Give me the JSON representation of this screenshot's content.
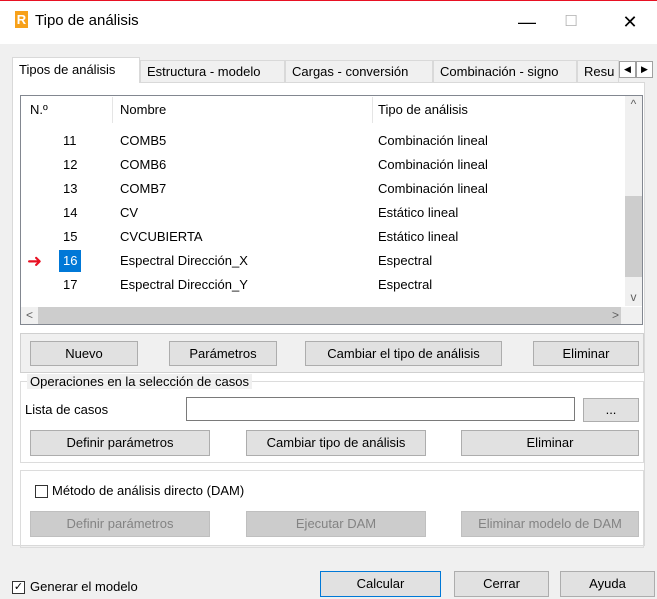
{
  "window": {
    "title": "Tipo de análisis",
    "app_icon_letter": "R",
    "minimize_glyph": "—",
    "maximize_glyph": "☐",
    "close_glyph": "✕"
  },
  "tabs": [
    {
      "label": "Tipos de análisis",
      "active": true
    },
    {
      "label": "Estructura - modelo",
      "active": false
    },
    {
      "label": "Cargas - conversión",
      "active": false
    },
    {
      "label": "Combinación - signo",
      "active": false
    },
    {
      "label": "Resu",
      "active": false
    }
  ],
  "tab_scroll": {
    "left": "◀",
    "right": "▶"
  },
  "list": {
    "columns": {
      "num": "N.º",
      "name": "Nombre",
      "type": "Tipo de análisis"
    },
    "rows": [
      {
        "num": "11",
        "name": "COMB5",
        "type": "Combinación lineal",
        "selected": false
      },
      {
        "num": "12",
        "name": "COMB6",
        "type": "Combinación lineal",
        "selected": false
      },
      {
        "num": "13",
        "name": "COMB7",
        "type": "Combinación lineal",
        "selected": false
      },
      {
        "num": "14",
        "name": "CV",
        "type": "Estático lineal",
        "selected": false
      },
      {
        "num": "15",
        "name": "CVCUBIERTA",
        "type": "Estático lineal",
        "selected": false
      },
      {
        "num": "16",
        "name": "Espectral  Dirección_X",
        "type": "Espectral",
        "selected": true
      },
      {
        "num": "17",
        "name": "Espectral  Dirección_Y",
        "type": "Espectral",
        "selected": false
      }
    ],
    "scroll": {
      "up": "^",
      "down": "v",
      "left": "<",
      "right": ">"
    },
    "pointer_glyph": "➜"
  },
  "top_buttons": {
    "new": "Nuevo",
    "params": "Parámetros",
    "change_type": "Cambiar el tipo de análisis",
    "delete": "Eliminar"
  },
  "case_ops": {
    "group_title": "Operaciones en la selección de casos",
    "case_list_label": "Lista de casos",
    "case_list_value": "",
    "browse": "...",
    "define_params": "Definir parámetros",
    "change_type": "Cambiar tipo de análisis",
    "delete": "Eliminar"
  },
  "dam": {
    "checkbox_label": "Método de análisis directo (DAM)",
    "checked": false,
    "define_params": "Definir parámetros",
    "run": "Ejecutar DAM",
    "delete_model": "Eliminar modelo de DAM"
  },
  "footer": {
    "generate_model_label": "Generar el modelo",
    "generate_model_checked": "✓",
    "calculate": "Calcular",
    "close": "Cerrar",
    "help": "Ayuda"
  }
}
